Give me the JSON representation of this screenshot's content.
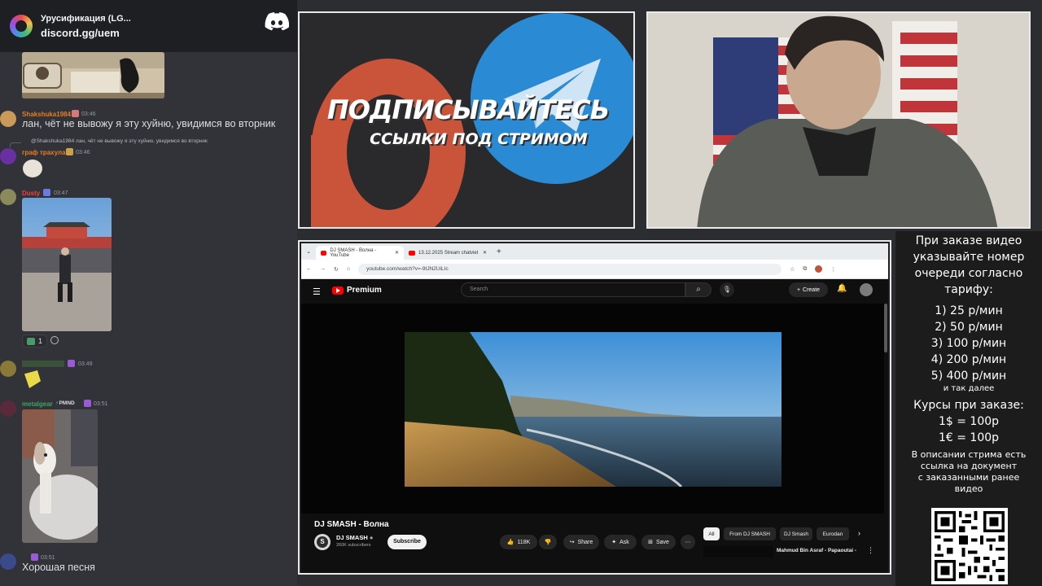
{
  "discord": {
    "server_name": "Урусификация (LG...",
    "invite": "discord.gg/uem",
    "messages": [
      {
        "name": "Shakshuka1984",
        "time": "03:46",
        "text": "лан, чёт не вывожу я эту хуйню, увидимся во вторник",
        "color": "#e67e22"
      },
      {
        "reply": "@Shakshuka1984 лан, чёт не вывожу я эту хуйню, увидимся во вторник",
        "name": "граф трахула",
        "time": "03:46",
        "color": "#e67e22"
      },
      {
        "name": "Dusty",
        "time": "03:47",
        "color": "#ed4245"
      },
      {
        "reaction_count": "1"
      },
      {
        "name": "",
        "time": "03:49",
        "color": "#3ba55d"
      },
      {
        "name": "metalgear",
        "tag": "PMND",
        "time": "03:51",
        "color": "#3ba55d"
      },
      {
        "name": "",
        "time": "03:51",
        "text": "Хорошая песня",
        "color": "#dbdee1"
      }
    ]
  },
  "banner": {
    "title": "ПОДПИСЫВАЙТЕСЬ",
    "subtitle": "ССЫЛКИ ПОД СТРИМОМ",
    "p_color": "#c9543a",
    "telegram_color": "#2a8bd4"
  },
  "browser": {
    "tabs": [
      {
        "label": "DJ SMASH - Волна - YouTube"
      },
      {
        "label": "13.12.2025 Stream chatviet"
      }
    ],
    "url": "youtube.com/watch?v=-9tJN2UiLIc",
    "youtube": {
      "logo": "Premium",
      "search_placeholder": "Search",
      "create_label": "Create",
      "video_title": "DJ SMASH - Волна",
      "channel": "DJ SMASH",
      "channel_logo_letter": "S",
      "subscribers": "260K subscribers",
      "subscribe_label": "Subscribe",
      "likes": "118K",
      "share_label": "Share",
      "ask_label": "Ask",
      "save_label": "Save",
      "chips": [
        "All",
        "From DJ SMASH",
        "DJ Smash",
        "Eurodan"
      ],
      "next_video_title": "Mahmud Bin Asraf - Papaoutai -"
    }
  },
  "info": {
    "intro": [
      "При заказе видео",
      "указывайте номер",
      "очереди согласно",
      "тарифу:"
    ],
    "tariffs": [
      "1) 25 р/мин",
      "2) 50 р/мин",
      "3) 100 р/мин",
      "4) 200 р/мин",
      "5) 400 р/мин"
    ],
    "tariffs_more": "и так далее",
    "rates_title": "Курсы при заказе:",
    "rates": [
      "1$ = 100р",
      "1€ = 100р"
    ],
    "description": [
      "В описании стрима есть",
      "ссылка на документ",
      "с заказанными ранее",
      "видео"
    ]
  }
}
